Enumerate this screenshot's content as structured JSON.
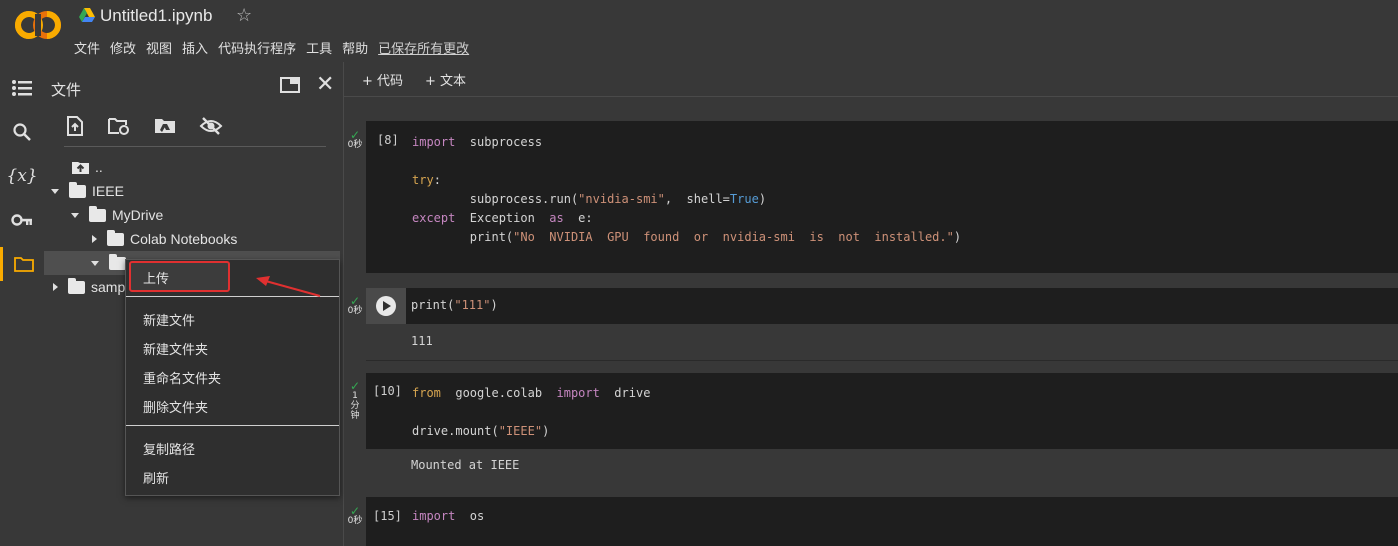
{
  "header": {
    "logo_text": "CO",
    "title": "Untitled1.ipynb",
    "star_icon": "star-icon",
    "menu": [
      "文件",
      "修改",
      "视图",
      "插入",
      "代码执行程序",
      "工具",
      "帮助"
    ],
    "saved_status": "已保存所有更改"
  },
  "side_panel": {
    "title": "文件",
    "toolbar_icons": [
      "upload-file-icon",
      "refresh-folder-icon",
      "mount-drive-icon",
      "hide-files-icon"
    ],
    "tree": {
      "parent": "..",
      "ieee": "IEEE",
      "mydrive": "MyDrive",
      "colab": "Colab Notebooks",
      "sample": "samp"
    }
  },
  "context_menu": {
    "upload": "上传",
    "new_file": "新建文件",
    "new_folder": "新建文件夹",
    "rename_folder": "重命名文件夹",
    "delete_folder": "删除文件夹",
    "copy_path": "复制路径",
    "refresh": "刷新"
  },
  "notebook": {
    "toolbar": {
      "add_code": "+ 代码",
      "add_text": "+ 文本"
    },
    "cells": [
      {
        "prompt": "[8]",
        "status": "0秒"
      },
      {
        "prompt": "",
        "status": "0秒",
        "output": "111"
      },
      {
        "prompt": "[10]",
        "status": "1分钟",
        "output": "Mounted at IEEE"
      },
      {
        "prompt": "[15]",
        "status": "0秒"
      }
    ]
  },
  "colors": {
    "accent": "#f9ab00",
    "highlight_border": "#e03030",
    "check": "#34a853"
  }
}
